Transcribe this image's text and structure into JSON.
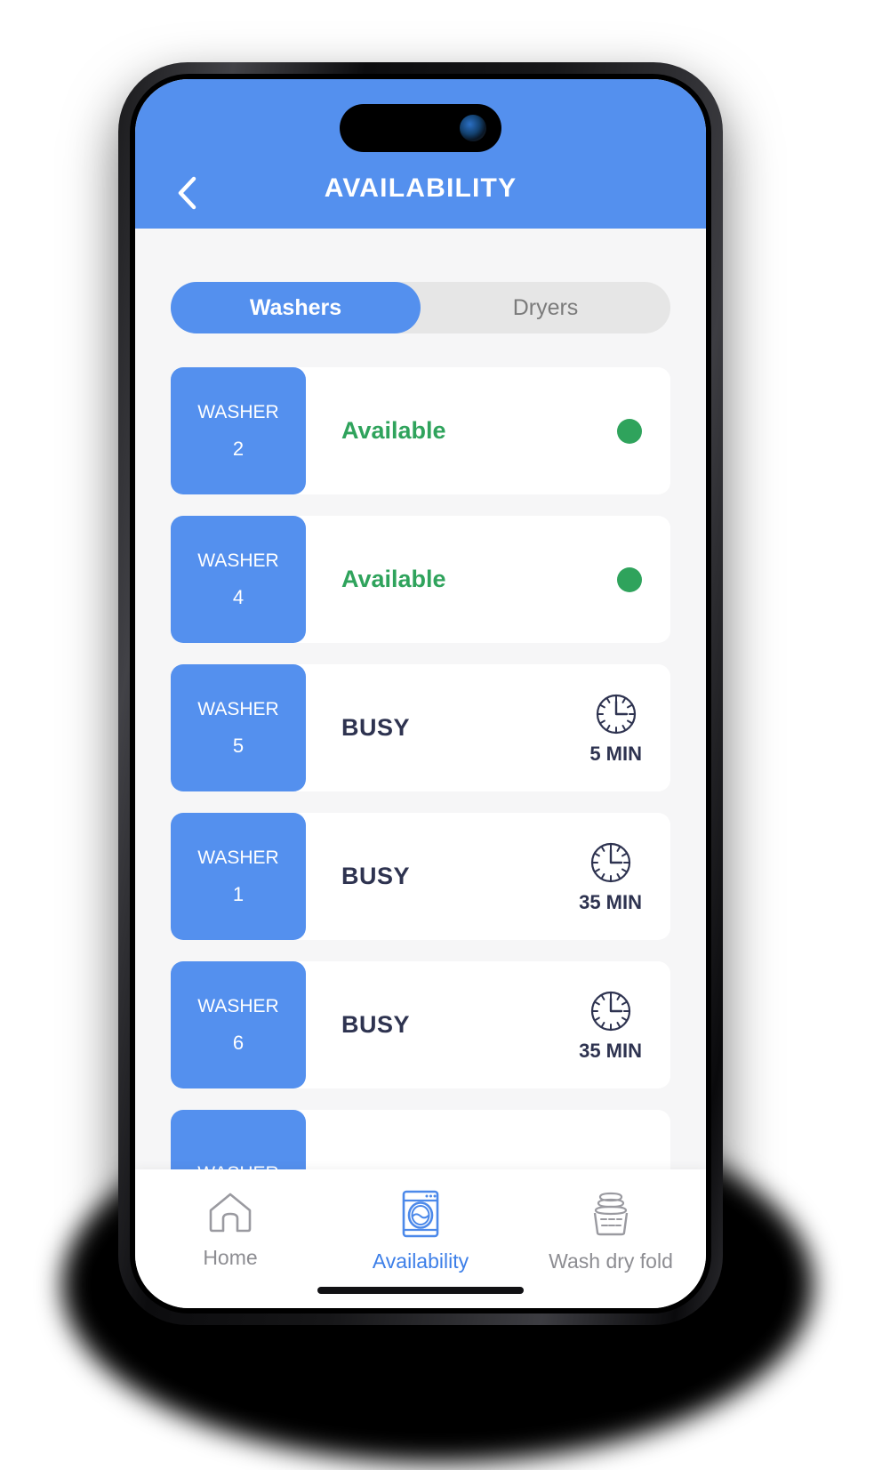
{
  "header": {
    "title": "AVAILABILITY",
    "back_icon": "chevron-left-icon",
    "background_color": "#5490ee",
    "title_color": "#ffffff"
  },
  "device": {
    "island_icon": "dynamic-island",
    "camera_icon": "front-camera-lens",
    "home_indicator": "home-indicator"
  },
  "segmented_control": {
    "tabs": [
      {
        "label": "Washers",
        "active": true
      },
      {
        "label": "Dryers",
        "active": false
      }
    ],
    "active_color": "#5490ee",
    "track_color": "#e6e6e6"
  },
  "machines": {
    "type_label": "WASHER",
    "available_label": "Available",
    "busy_label": "BUSY",
    "available_color": "#2fa35c",
    "busy_color": "#2e3350",
    "tile_color": "#5490ee",
    "items": [
      {
        "number": "2",
        "status": "Available",
        "state": "available",
        "time": ""
      },
      {
        "number": "4",
        "status": "Available",
        "state": "available",
        "time": ""
      },
      {
        "number": "5",
        "status": "BUSY",
        "state": "busy",
        "time": "5 MIN"
      },
      {
        "number": "1",
        "status": "BUSY",
        "state": "busy",
        "time": "35 MIN"
      },
      {
        "number": "6",
        "status": "BUSY",
        "state": "busy",
        "time": "35 MIN"
      },
      {
        "number": "",
        "status": "",
        "state": "partial",
        "time": ""
      }
    ]
  },
  "bottom_nav": {
    "items": [
      {
        "label": "Home",
        "icon": "home-icon",
        "active": false
      },
      {
        "label": "Availability",
        "icon": "washing-machine-icon",
        "active": true
      },
      {
        "label": "Wash dry fold",
        "icon": "laundry-basket-icon",
        "active": false
      }
    ],
    "active_color": "#3d7fe8",
    "inactive_color": "#8d8d92"
  }
}
